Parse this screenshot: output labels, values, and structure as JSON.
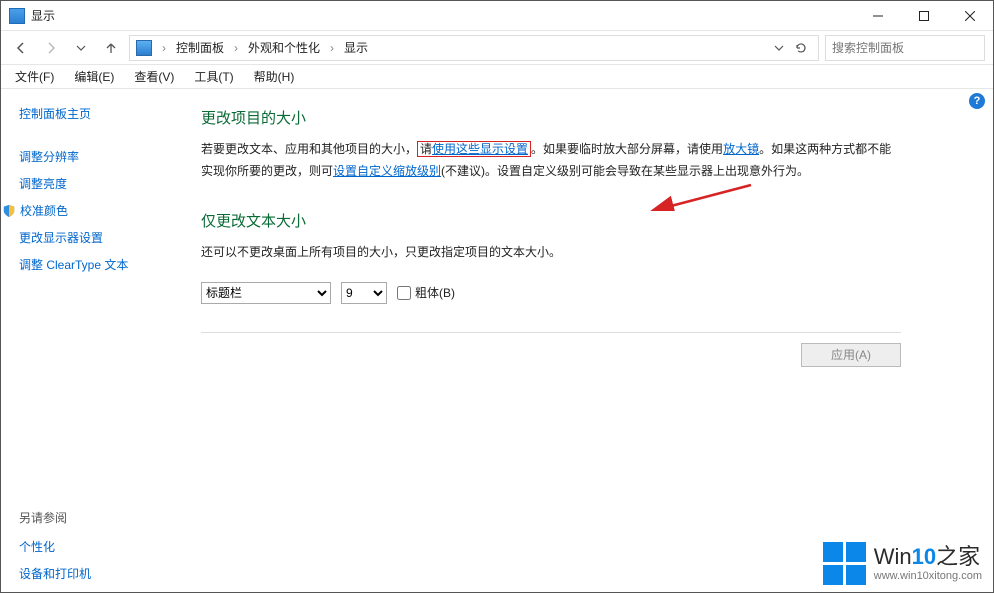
{
  "titlebar": {
    "title": "显示"
  },
  "address": {
    "crumbs": [
      "控制面板",
      "外观和个性化",
      "显示"
    ],
    "search_placeholder": "搜索控制面板"
  },
  "menubar": {
    "file": "文件(F)",
    "edit": "编辑(E)",
    "view": "查看(V)",
    "tools": "工具(T)",
    "help": "帮助(H)"
  },
  "sidebar": {
    "home": "控制面板主页",
    "links": {
      "adjust_resolution": "调整分辨率",
      "adjust_brightness": "调整亮度",
      "calibrate_color": "校准颜色",
      "change_display_settings": "更改显示器设置",
      "adjust_cleartype": "调整 ClearType 文本"
    },
    "see_also_h": "另请参阅",
    "see_also": {
      "personalize": "个性化",
      "devices": "设备和打印机"
    }
  },
  "content": {
    "section1_h": "更改项目的大小",
    "para1_pre": "若要更改文本、应用和其他项目的大小，",
    "link_highlight_pre": "请",
    "link_highlight": "使用这些显示设置",
    "para1_mid": "。如果要临时放大部分屏幕，请使用",
    "link_magnifier": "放大镜",
    "para1_mid2": "。如果这两种方式都不能实现你所要的更改，则可",
    "link_custom": "设置自定义缩放级别",
    "para1_tail": "(不建议)。设置自定义级别可能会导致在某些显示器上出现意外行为。",
    "section2_h": "仅更改文本大小",
    "para2": "还可以不更改桌面上所有项目的大小，只更改指定项目的文本大小。",
    "item_select": "标题栏",
    "size_select": "9",
    "bold_label": "粗体(B)",
    "apply_label": "应用(A)"
  },
  "watermark": {
    "brand1": "Win",
    "brand2": "10",
    "brand3": "之家",
    "url": "www.win10xitong.com"
  }
}
